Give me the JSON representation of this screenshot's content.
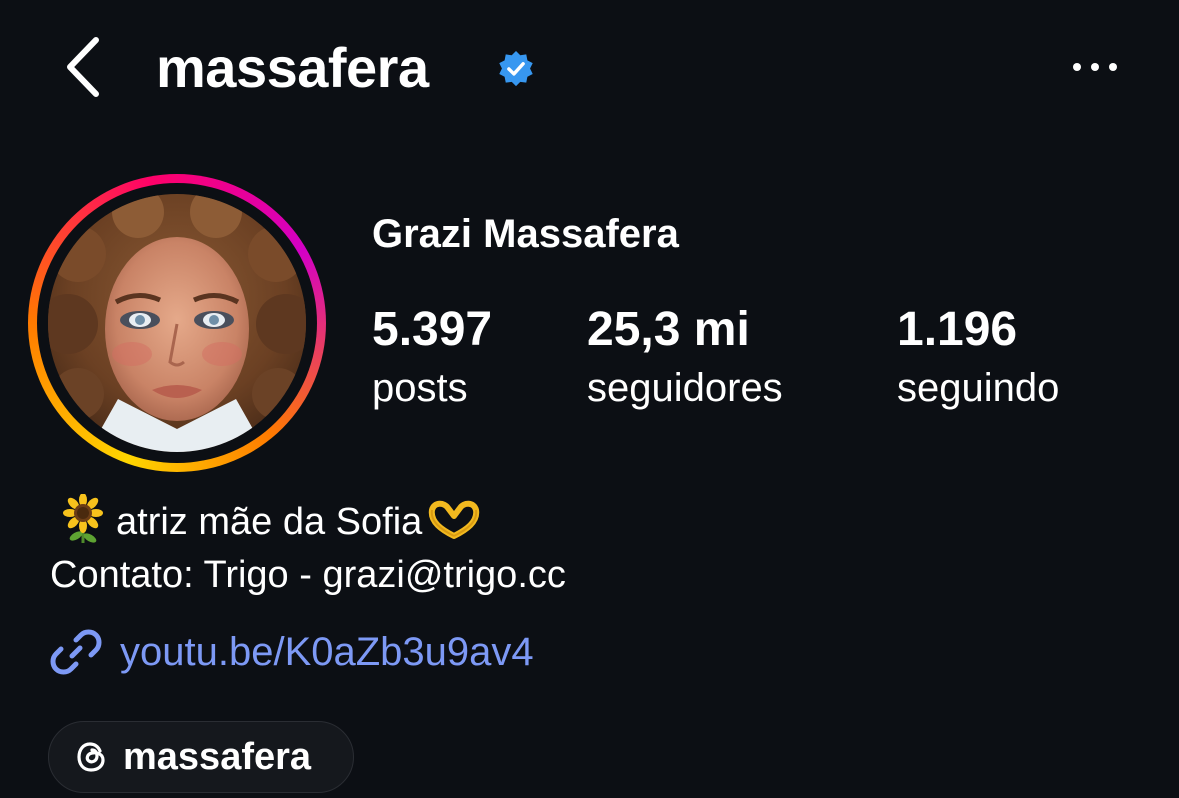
{
  "header": {
    "username": "massafera",
    "verified": true,
    "back_icon": "chevron-left-icon",
    "more_icon": "more-horizontal-icon",
    "verified_color": "#3797f0"
  },
  "profile": {
    "display_name": "Grazi Massafera",
    "avatar_ring_colors": [
      "#ffd600",
      "#ff7a00",
      "#ff0169",
      "#d300c5"
    ],
    "stats": [
      {
        "value": "5.397",
        "label": "posts"
      },
      {
        "value": "25,3 mi",
        "label": "seguidores"
      },
      {
        "value": "1.196",
        "label": "seguindo"
      }
    ]
  },
  "bio": {
    "line1": "atriz mãe da Sofia",
    "line2": "Contato: Trigo - grazi@trigo.cc",
    "line1_leading_emoji": "sunflower-icon",
    "line1_trailing_emoji": "heart-hands-icon"
  },
  "link": {
    "icon": "link-icon",
    "text": "youtu.be/K0aZb3u9av4",
    "color": "#7d99f5"
  },
  "threads": {
    "icon": "threads-icon",
    "label": "massafera"
  }
}
